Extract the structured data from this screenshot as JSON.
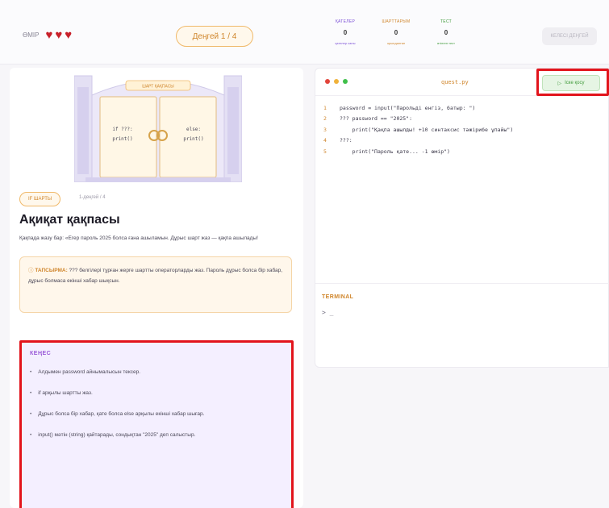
{
  "topbar": {
    "lives_label": "ӨМІР",
    "hearts": [
      "♥",
      "♥",
      "♥"
    ],
    "level_pill": "Деңгей 1 / 4",
    "stats": [
      {
        "label": "ҚАТЕЛЕР",
        "value": "0",
        "sub": "қателер саны",
        "color": "#7b4fd6"
      },
      {
        "label": "ШАРТТАРЫМ",
        "value": "0",
        "sub": "орындалған",
        "color": "#d0862c"
      },
      {
        "label": "ТЕСТ",
        "value": "0",
        "sub": "өтілген тест",
        "color": "#3f9a3a"
      }
    ],
    "next_button": "КЕЛЕСІ ДЕҢГЕЙ"
  },
  "left": {
    "gate_labels": {
      "sign": "ШАРТ ҚАҚПАСЫ",
      "left_door": [
        "if ???:",
        "print()"
      ],
      "right_door": [
        "else:",
        "print()"
      ]
    },
    "tag": "IF ШАРТЫ",
    "level_small": "1-деңгей / 4",
    "title": "Ақиқат қақпасы",
    "description": "Қақпада жазу бар: «Егер пароль 2025 болса ғана ашыламын. Дұрыс шарт жаз — қақпа ашылады!",
    "task_label": "ТАПСЫРМА:",
    "task_text": "??? белгілері тұрған жерге шартты операторларды жаз. Пароль дұрыс болса бір хабар, дұрыс болмаса екінші хабар шықсын.",
    "hint_title": "КЕҢЕС",
    "hints": [
      "Алдымен password айнымалысын тексер.",
      "if арқылы шартты жаз.",
      "Дұрыс болса бір хабар, қате болса else арқылы екінші хабар шығар.",
      "input() мәтін (string) қайтарады, сондықтан \"2025\" деп салыстыр."
    ]
  },
  "editor": {
    "filename": "quest.py",
    "run_button": "Іске қосу",
    "code_lines": [
      {
        "n": "1",
        "text": "password = input(\"Парольді енгіз, батыр: \")"
      },
      {
        "n": "2",
        "text": "??? password == \"2025\":"
      },
      {
        "n": "3",
        "text": "    print(\"Қақпа ашылды! +10 синтаксис тәжірибе ұпайы\")"
      },
      {
        "n": "4",
        "text": "???:"
      },
      {
        "n": "5",
        "text": "    print(\"Пароль қате... -1 өмір\")"
      }
    ],
    "terminal_label": "TERMINAL",
    "terminal_prompt": "> _"
  },
  "colors": {
    "accent_orange": "#d0862c",
    "accent_purple": "#9a5ad8",
    "heart_red": "#c8202a",
    "highlight_red": "#e2141c",
    "run_green": "#3f9a3a"
  }
}
